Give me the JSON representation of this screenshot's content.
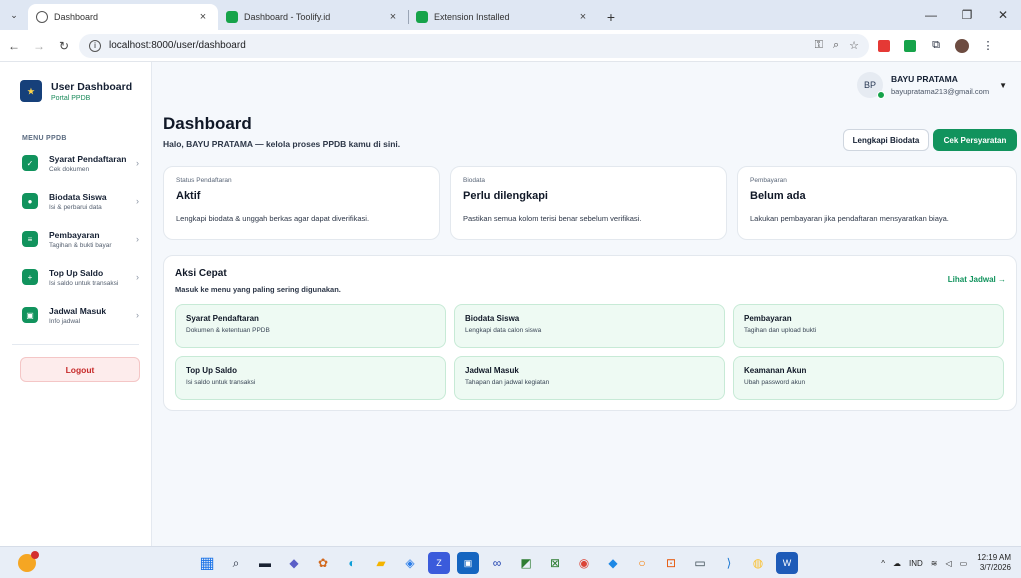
{
  "browser": {
    "tabs": [
      {
        "title": "Dashboard",
        "active": true
      },
      {
        "title": "Dashboard - Toolify.id",
        "active": false
      },
      {
        "title": "Extension Installed",
        "active": false
      }
    ],
    "url": "localhost:8000/user/dashboard"
  },
  "sidebar": {
    "brand_title": "User Dashboard",
    "brand_sub": "Portal PPDB",
    "menu_heading": "MENU PPDB",
    "items": [
      {
        "label": "Syarat Pendaftaran",
        "sub": "Cek dokumen",
        "icon": "check-icon"
      },
      {
        "label": "Biodata Siswa",
        "sub": "Isi & perbarui data",
        "icon": "user-icon"
      },
      {
        "label": "Pembayaran",
        "sub": "Tagihan & bukti bayar",
        "icon": "bill-icon"
      },
      {
        "label": "Top Up Saldo",
        "sub": "Isi saldo untuk transaksi",
        "icon": "plus-icon"
      },
      {
        "label": "Jadwal Masuk",
        "sub": "Info jadwal",
        "icon": "calendar-icon"
      }
    ],
    "logout": "Logout"
  },
  "user": {
    "initials": "BP",
    "name": "BAYU PRATAMA",
    "email": "bayupratama213@gmail.com"
  },
  "header": {
    "title": "Dashboard",
    "subtitle": "Halo, BAYU PRATAMA — kelola proses PPDB kamu di sini.",
    "btn_biodata": "Lengkapi Biodata",
    "btn_syarat": "Cek Persyaratan"
  },
  "stats": [
    {
      "label": "Status Pendaftaran",
      "value": "Aktif",
      "desc": "Lengkapi biodata & unggah berkas agar dapat diverifikasi."
    },
    {
      "label": "Biodata",
      "value": "Perlu dilengkapi",
      "desc": "Pastikan semua kolom terisi benar sebelum verifikasi."
    },
    {
      "label": "Pembayaran",
      "value": "Belum ada",
      "desc": "Lakukan pembayaran jika pendaftaran mensyaratkan biaya."
    }
  ],
  "quick": {
    "title": "Aksi Cepat",
    "subtitle": "Masuk ke menu yang paling sering digunakan.",
    "link": "Lihat Jadwal →",
    "cards": [
      {
        "title": "Syarat Pendaftaran",
        "desc": "Dokumen & ketentuan PPDB"
      },
      {
        "title": "Biodata Siswa",
        "desc": "Lengkapi data calon siswa"
      },
      {
        "title": "Pembayaran",
        "desc": "Tagihan dan upload bukti"
      },
      {
        "title": "Top Up Saldo",
        "desc": "Isi saldo untuk transaksi"
      },
      {
        "title": "Jadwal Masuk",
        "desc": "Tahapan dan jadwal kegiatan"
      },
      {
        "title": "Keamanan Akun",
        "desc": "Ubah password akun"
      }
    ]
  },
  "taskbar": {
    "lang": "IND",
    "time": "12:19 AM",
    "date": "3/7/2026"
  },
  "colors": {
    "accent": "#11935d",
    "danger": "#c62828"
  }
}
